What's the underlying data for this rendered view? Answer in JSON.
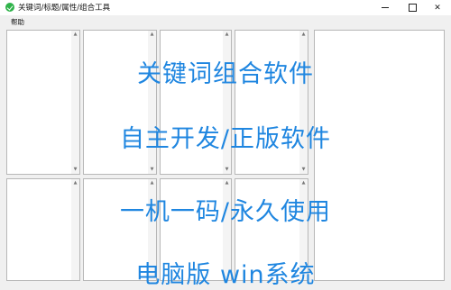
{
  "window": {
    "title": "关键词/标题/属性/组合工具",
    "minimize_glyph": "",
    "close_glyph": "✕"
  },
  "menu": {
    "help_label": "帮助"
  },
  "scroll": {
    "up_glyph": "▲",
    "down_glyph": "▼"
  },
  "overlay": {
    "line1": "关键词组合软件",
    "line2": "自主开发/正版软件",
    "line3": "一机一码/永久使用",
    "line4": "电脑版 win系统"
  },
  "colors": {
    "overlay_text": "#1f86e0",
    "accent": "#2fb34a"
  }
}
